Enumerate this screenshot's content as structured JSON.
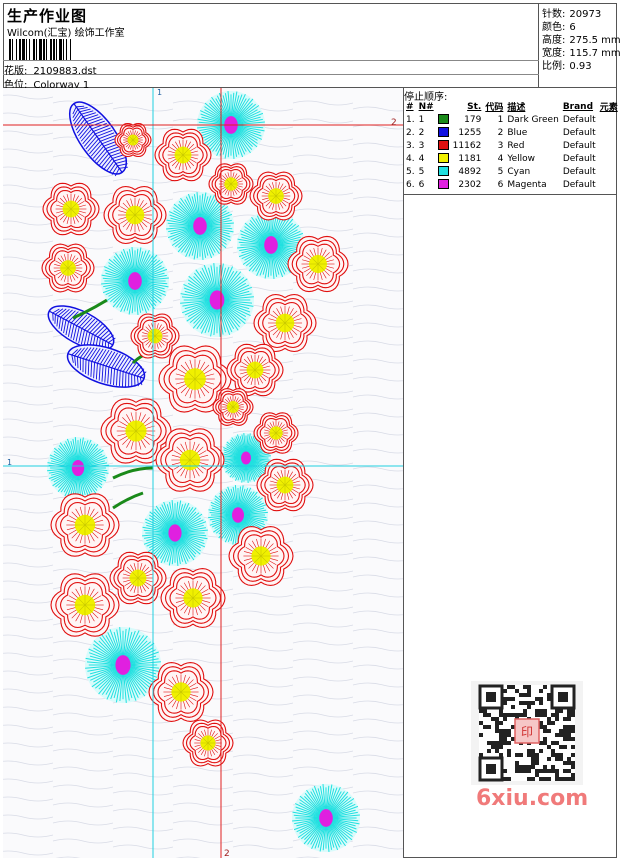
{
  "header": {
    "title": "生产作业图",
    "studio": "Wilcom(汇宝) 绘饰工作室",
    "design_label": "花版:",
    "design_value": "2109883.dst",
    "colorway_label": "色位:",
    "colorway_value": "Colorway 1"
  },
  "stats": {
    "stitches_label": "针数:",
    "stitches_value": "20973",
    "colors_label": "颜色:",
    "colors_value": "6",
    "height_label": "高度:",
    "height_value": "275.5 mm",
    "width_label": "宽度:",
    "width_value": "115.7 mm",
    "scale_label": "比例:",
    "scale_value": "0.93"
  },
  "stop_sequence": {
    "caption": "停止顺序:",
    "headers": [
      "#",
      "N#",
      "St.",
      "代码",
      "描述",
      "Brand",
      "元素"
    ],
    "rows": [
      {
        "num": "1.",
        "n": "1",
        "color": "#1a8a1a",
        "st": "179",
        "code": "1",
        "desc": "Dark Green",
        "brand": "Default"
      },
      {
        "num": "2.",
        "n": "2",
        "color": "#1010e0",
        "st": "1255",
        "code": "2",
        "desc": "Blue",
        "brand": "Default"
      },
      {
        "num": "3.",
        "n": "3",
        "color": "#e01010",
        "st": "11162",
        "code": "3",
        "desc": "Red",
        "brand": "Default"
      },
      {
        "num": "4.",
        "n": "4",
        "color": "#f0f000",
        "st": "1181",
        "code": "4",
        "desc": "Yellow",
        "brand": "Default"
      },
      {
        "num": "5.",
        "n": "5",
        "color": "#20e0e0",
        "st": "4892",
        "code": "5",
        "desc": "Cyan",
        "brand": "Default"
      },
      {
        "num": "6.",
        "n": "6",
        "color": "#e020e0",
        "st": "2302",
        "code": "6",
        "desc": "Magenta",
        "brand": "Default"
      }
    ]
  },
  "guides": {
    "marker_1": "1",
    "marker_2": "2"
  },
  "watermark": {
    "text": "6xiu.com",
    "seal": "印"
  },
  "colors": {
    "red": "#e01010",
    "cyan": "#20e0e0",
    "magenta": "#e020e0",
    "yellow": "#f0f000",
    "blue": "#1010e0",
    "green": "#1a8a1a"
  }
}
